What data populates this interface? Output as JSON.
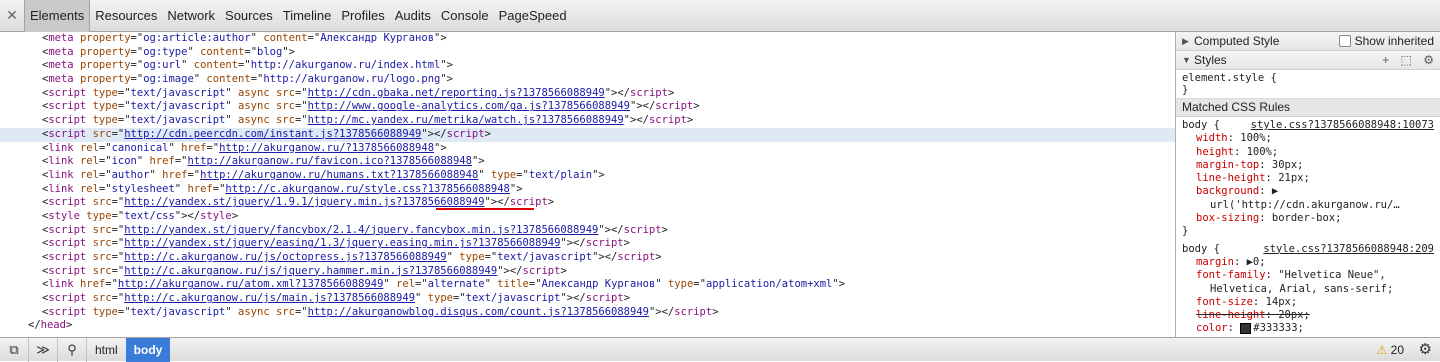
{
  "tabs": [
    "Elements",
    "Resources",
    "Network",
    "Sources",
    "Timeline",
    "Profiles",
    "Audits",
    "Console",
    "PageSpeed"
  ],
  "dom_lines": [
    {
      "indent": 3,
      "html": "&lt;<span class='tag'>meta</span> <span class='attr'>property</span>=\"<span class='val'>og:article:author</span>\" <span class='attr'>content</span>=\"<span class='val'>Александр Курганов</span>\"&gt;"
    },
    {
      "indent": 3,
      "html": "&lt;<span class='tag'>meta</span> <span class='attr'>property</span>=\"<span class='val'>og:type</span>\" <span class='attr'>content</span>=\"<span class='val'>blog</span>\"&gt;"
    },
    {
      "indent": 3,
      "html": "&lt;<span class='tag'>meta</span> <span class='attr'>property</span>=\"<span class='val'>og:url</span>\" <span class='attr'>content</span>=\"<span class='val'>http://akurganow.ru/index.html</span>\"&gt;"
    },
    {
      "indent": 3,
      "html": "&lt;<span class='tag'>meta</span> <span class='attr'>property</span>=\"<span class='val'>og:image</span>\" <span class='attr'>content</span>=\"<span class='val'>http://akurganow.ru/logo.png</span>\"&gt;"
    },
    {
      "indent": 3,
      "html": "&lt;<span class='tag'>script</span> <span class='attr'>type</span>=\"<span class='val'>text/javascript</span>\" <span class='attr'>async</span> <span class='attr'>src</span>=\"<span class='lnk'>http://cdn.gbaka.net/reporting.js?1378566088949</span>\"&gt;&lt;/<span class='tag'>script</span>&gt;"
    },
    {
      "indent": 3,
      "html": "&lt;<span class='tag'>script</span> <span class='attr'>type</span>=\"<span class='val'>text/javascript</span>\" <span class='attr'>async</span> <span class='attr'>src</span>=\"<span class='lnk'>http://www.google-analytics.com/ga.js?1378566088949</span>\"&gt;&lt;/<span class='tag'>script</span>&gt;"
    },
    {
      "indent": 3,
      "html": "&lt;<span class='tag'>script</span> <span class='attr'>type</span>=\"<span class='val'>text/javascript</span>\" <span class='attr'>async</span> <span class='attr'>src</span>=\"<span class='lnk'>http://mc.yandex.ru/metrika/watch.js?1378566088949</span>\"&gt;&lt;/<span class='tag'>script</span>&gt;"
    },
    {
      "indent": 3,
      "sel": true,
      "html": "&lt;<span class='tag'>script</span> <span class='attr'>src</span>=\"<span class='lnk'>http://cdn.peercdn.com/instant.js?1378566088949</span>\"&gt;&lt;/<span class='tag'>script</span>&gt;"
    },
    {
      "indent": 3,
      "html": "&lt;<span class='tag'>link</span> <span class='attr'>rel</span>=\"<span class='val'>canonical</span>\" <span class='attr'>href</span>=\"<span class='lnk'>http://akurganow.ru/?1378566088948</span>\"&gt;"
    },
    {
      "indent": 3,
      "html": "&lt;<span class='tag'>link</span> <span class='attr'>rel</span>=\"<span class='val'>icon</span>\" <span class='attr'>href</span>=\"<span class='lnk'>http://akurganow.ru/favicon.ico?1378566088948</span>\"&gt;"
    },
    {
      "indent": 3,
      "html": "&lt;<span class='tag'>link</span> <span class='attr'>rel</span>=\"<span class='val'>author</span>\" <span class='attr'>href</span>=\"<span class='lnk'>http://akurganow.ru/humans.txt?1378566088948</span>\" <span class='attr'>type</span>=\"<span class='val'>text/plain</span>\"&gt;"
    },
    {
      "indent": 3,
      "html": "&lt;<span class='tag'>link</span> <span class='attr'>rel</span>=\"<span class='val'>stylesheet</span>\" <span class='attr'>href</span>=\"<span class='lnk'>http://c.akurganow.ru/style.css?1378566088948</span>\"&gt;"
    },
    {
      "indent": 3,
      "html": "&lt;<span class='tag'>script</span> <span class='attr'>src</span>=\"<span class='lnk'>http://yandex.st/jquery/1.9.1/jquery.min.js?1378566088949</span>\"&gt;&lt;/<span class='tag'>script</span>&gt;",
      "squiggle": true
    },
    {
      "indent": 3,
      "html": "&lt;<span class='tag'>style</span> <span class='attr'>type</span>=\"<span class='val'>text/css</span>\"&gt;&lt;/<span class='tag'>style</span>&gt;"
    },
    {
      "indent": 3,
      "html": "&lt;<span class='tag'>script</span> <span class='attr'>src</span>=\"<span class='lnk'>http://yandex.st/jquery/fancybox/2.1.4/jquery.fancybox.min.js?1378566088949</span>\"&gt;&lt;/<span class='tag'>script</span>&gt;"
    },
    {
      "indent": 3,
      "html": "&lt;<span class='tag'>script</span> <span class='attr'>src</span>=\"<span class='lnk'>http://yandex.st/jquery/easing/1.3/jquery.easing.min.js?1378566088949</span>\"&gt;&lt;/<span class='tag'>script</span>&gt;"
    },
    {
      "indent": 3,
      "html": "&lt;<span class='tag'>script</span> <span class='attr'>src</span>=\"<span class='lnk'>http://c.akurganow.ru/js/octopress.js?1378566088949</span>\" <span class='attr'>type</span>=\"<span class='val'>text/javascript</span>\"&gt;&lt;/<span class='tag'>script</span>&gt;"
    },
    {
      "indent": 3,
      "html": "&lt;<span class='tag'>script</span> <span class='attr'>src</span>=\"<span class='lnk'>http://c.akurganow.ru/js/jquery.hammer.min.js?1378566088949</span>\"&gt;&lt;/<span class='tag'>script</span>&gt;"
    },
    {
      "indent": 3,
      "html": "&lt;<span class='tag'>link</span> <span class='attr'>href</span>=\"<span class='lnk'>http://akurganow.ru/atom.xml?1378566088949</span>\" <span class='attr'>rel</span>=\"<span class='val'>alternate</span>\" <span class='attr'>title</span>=\"<span class='val'>Александр Курганов</span>\" <span class='attr'>type</span>=\"<span class='val'>application/atom+xml</span>\"&gt;"
    },
    {
      "indent": 3,
      "html": "&lt;<span class='tag'>script</span> <span class='attr'>src</span>=\"<span class='lnk'>http://c.akurganow.ru/js/main.js?1378566088949</span>\" <span class='attr'>type</span>=\"<span class='val'>text/javascript</span>\"&gt;&lt;/<span class='tag'>script</span>&gt;"
    },
    {
      "indent": 3,
      "html": "&lt;<span class='tag'>script</span> <span class='attr'>type</span>=\"<span class='val'>text/javascript</span>\" <span class='attr'>async</span> <span class='attr'>src</span>=\"<span class='lnk'>http://akurganowblog.disqus.com/count.js?1378566088949</span>\"&gt;&lt;/<span class='tag'>script</span>&gt;"
    },
    {
      "indent": 2,
      "html": "&lt;/<span class='tag'>head</span>&gt;"
    }
  ],
  "sidebar": {
    "computed_style": "Computed Style",
    "show_inherited": "Show inherited",
    "styles": "Styles",
    "element_style_open": "element.style {",
    "close_brace": "}",
    "matched_css_rules": "Matched CSS Rules"
  },
  "rules": [
    {
      "selector": "body {",
      "source": "style.css?1378566088948:10073",
      "props": [
        {
          "name": "width",
          "value": "100%;"
        },
        {
          "name": "height",
          "value": "100%;"
        },
        {
          "name": "margin-top",
          "value": "30px;"
        },
        {
          "name": "line-height",
          "value": "21px;"
        },
        {
          "name": "background",
          "value": "▶"
        },
        {
          "name": "",
          "value": "url('http://cdn.akurganow.ru/…",
          "cont": true
        },
        {
          "name": "box-sizing",
          "value": "border-box;"
        }
      ]
    },
    {
      "selector": "body {",
      "source": "style.css?1378566088948:209",
      "props": [
        {
          "name": "margin",
          "value": "▶0;"
        },
        {
          "name": "font-family",
          "value": "\"Helvetica Neue\","
        },
        {
          "name": "",
          "value": "Helvetica, Arial, sans-serif;",
          "cont": true
        },
        {
          "name": "font-size",
          "value": "14px;"
        },
        {
          "name": "line-height",
          "value": "20px;",
          "strike": true
        },
        {
          "name": "color",
          "value": "#333333;",
          "swatch": true
        }
      ]
    }
  ],
  "status": {
    "crumbs": [
      "html",
      "body"
    ],
    "active_crumb": "body",
    "warnings": "20"
  }
}
